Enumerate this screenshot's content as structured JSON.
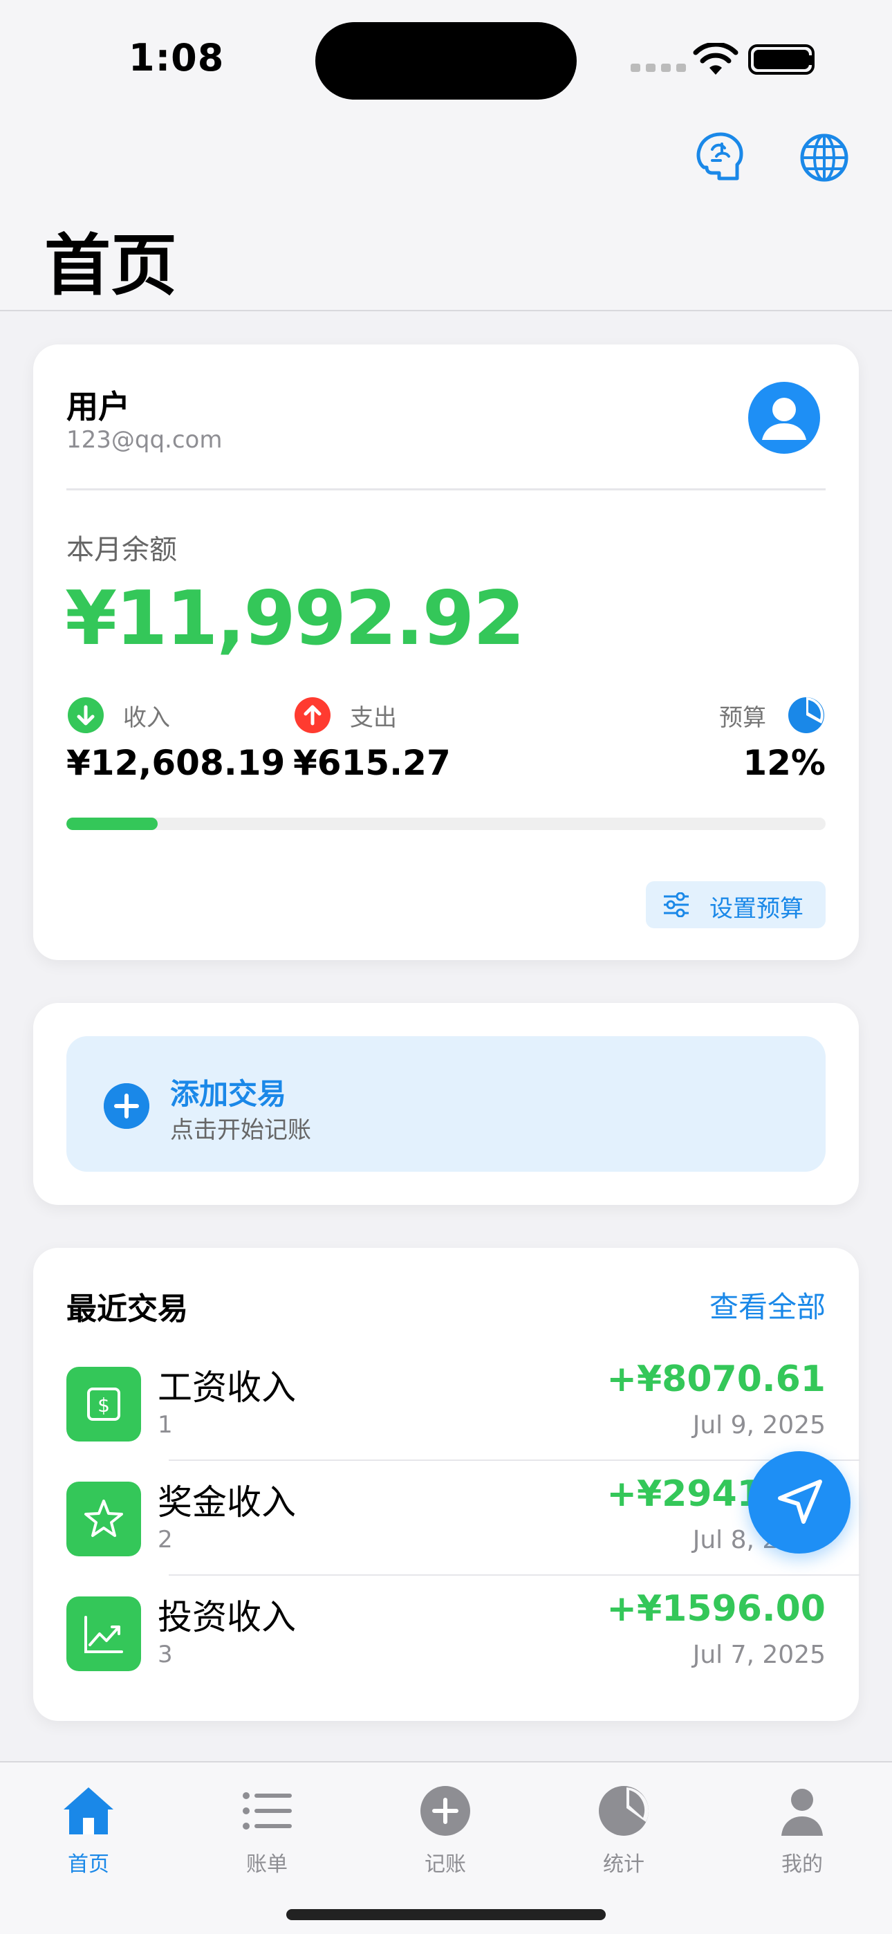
{
  "status_bar": {
    "time": "1:08"
  },
  "header": {
    "title": "首页",
    "icons": [
      "brain-icon",
      "globe-icon"
    ]
  },
  "account": {
    "name": "用户",
    "email": "123@qq.com",
    "balance_label": "本月余额",
    "balance": "¥11,992.92",
    "income_label": "收入",
    "income": "¥12,608.19",
    "expense_label": "支出",
    "expense": "¥615.27",
    "budget_label": "预算",
    "budget_percent": "12%",
    "budget_progress": 0.12,
    "set_budget": "设置预算"
  },
  "add_transaction": {
    "title": "添加交易",
    "subtitle": "点击开始记账"
  },
  "recent": {
    "title": "最近交易",
    "view_all": "查看全部",
    "items": [
      {
        "name": "工资收入",
        "note": "1",
        "amount": "+¥8070.61",
        "date": "Jul 9, 2025",
        "icon": "dollar-icon"
      },
      {
        "name": "奖金收入",
        "note": "2",
        "amount": "+¥2941.23",
        "date": "Jul 8, 2025",
        "icon": "star-icon"
      },
      {
        "name": "投资收入",
        "note": "3",
        "amount": "+¥1596.00",
        "date": "Jul 7, 2025",
        "icon": "chart-up-icon"
      }
    ]
  },
  "tabs": [
    {
      "label": "首页",
      "icon": "home-icon",
      "active": true
    },
    {
      "label": "账单",
      "icon": "list-icon",
      "active": false
    },
    {
      "label": "记账",
      "icon": "plus-circle-icon",
      "active": false
    },
    {
      "label": "统计",
      "icon": "pie-chart-icon",
      "active": false
    },
    {
      "label": "我的",
      "icon": "person-icon",
      "active": false
    }
  ],
  "colors": {
    "accent": "#1a88e8",
    "income": "#34c759",
    "expense": "#ff3b30"
  }
}
